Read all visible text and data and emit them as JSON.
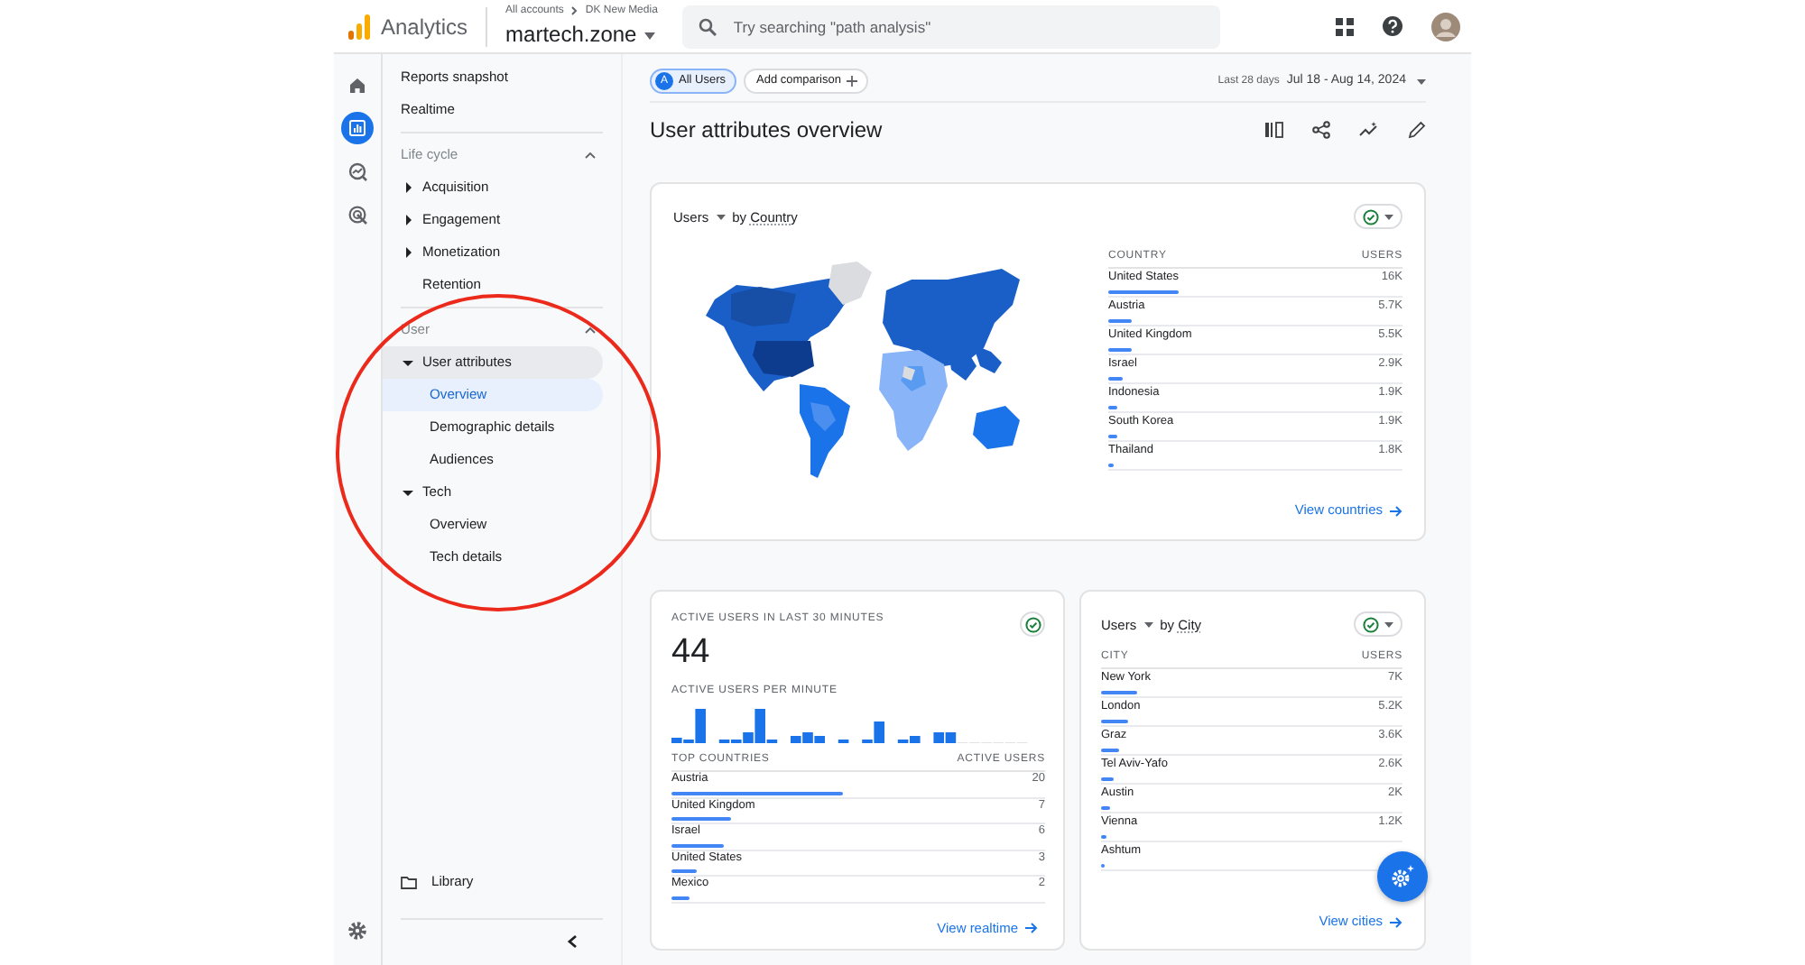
{
  "header": {
    "product": "Analytics",
    "breadcrumb": [
      "All accounts",
      "DK New Media"
    ],
    "property": "martech.zone",
    "search": {
      "placeholder": "Try searching \"path analysis\""
    }
  },
  "rail": [
    {
      "kind": "home",
      "selected": false
    },
    {
      "kind": "reports",
      "selected": true
    },
    {
      "kind": "explore",
      "selected": false
    },
    {
      "kind": "advertising",
      "selected": false
    }
  ],
  "nav": {
    "links": [
      {
        "label": "Reports snapshot",
        "selected": false
      },
      {
        "label": "Realtime",
        "selected": false
      }
    ],
    "sections": [
      {
        "title": "Life cycle",
        "expanded": true,
        "items": [
          {
            "label": "Acquisition",
            "expanded": false,
            "selected": false
          },
          {
            "label": "Engagement",
            "expanded": false,
            "selected": false
          },
          {
            "label": "Monetization",
            "expanded": false,
            "selected": false
          },
          {
            "label": "Retention",
            "selected": false
          }
        ]
      },
      {
        "title": "User",
        "expanded": true,
        "items": [
          {
            "label": "User attributes",
            "expanded": true,
            "selected": false,
            "children": [
              {
                "label": "Overview",
                "selected": true
              },
              {
                "label": "Demographic details",
                "selected": false
              },
              {
                "label": "Audiences",
                "selected": false
              }
            ]
          },
          {
            "label": "Tech",
            "expanded": true,
            "selected": false,
            "children": [
              {
                "label": "Overview",
                "selected": false
              },
              {
                "label": "Tech details",
                "selected": false
              }
            ]
          }
        ]
      }
    ],
    "library": "Library"
  },
  "comparisons": [
    {
      "kind": "segment",
      "letter": "A",
      "label": "All Users"
    },
    {
      "kind": "add",
      "label": "Add comparison"
    }
  ],
  "date": {
    "range_label": "Last 28 days",
    "range": "Jul 18 - Aug 14, 2024"
  },
  "title": "User attributes overview",
  "country_card": {
    "metric": "Users",
    "connector": "by",
    "dimension": "Country",
    "columns": [
      "COUNTRY",
      "USERS"
    ],
    "rows": [
      {
        "name": "United States",
        "value": "16K",
        "level": 0.24
      },
      {
        "name": "Austria",
        "value": "5.7K",
        "level": 0.08
      },
      {
        "name": "United Kingdom",
        "value": "5.5K",
        "level": 0.08
      },
      {
        "name": "Israel",
        "value": "2.9K",
        "level": 0.05
      },
      {
        "name": "Indonesia",
        "value": "1.9K",
        "level": 0.03
      },
      {
        "name": "South Korea",
        "value": "1.9K",
        "level": 0.03
      },
      {
        "name": "Thailand",
        "value": "1.8K",
        "level": 0.02
      }
    ],
    "link": "View countries"
  },
  "realtime_card": {
    "title": "ACTIVE USERS IN LAST 30 MINUTES",
    "value": "44",
    "subtitle": "ACTIVE USERS PER MINUTE",
    "columns": [
      "TOP COUNTRIES",
      "ACTIVE USERS"
    ],
    "rows": [
      {
        "name": "Austria",
        "value": "20",
        "level": 0.46
      },
      {
        "name": "United Kingdom",
        "value": "7",
        "level": 0.16
      },
      {
        "name": "Israel",
        "value": "6",
        "level": 0.14
      },
      {
        "name": "United States",
        "value": "3",
        "level": 0.07
      },
      {
        "name": "Mexico",
        "value": "2",
        "level": 0.05
      }
    ],
    "link": "View realtime"
  },
  "city_card": {
    "metric": "Users",
    "connector": "by",
    "dimension": "City",
    "columns": [
      "CITY",
      "USERS"
    ],
    "rows": [
      {
        "name": "New York",
        "value": "7K",
        "level": 0.12
      },
      {
        "name": "London",
        "value": "5.2K",
        "level": 0.09
      },
      {
        "name": "Graz",
        "value": "3.6K",
        "level": 0.06
      },
      {
        "name": "Tel Aviv-Yafo",
        "value": "2.6K",
        "level": 0.04
      },
      {
        "name": "Austin",
        "value": "2K",
        "level": 0.03
      },
      {
        "name": "Vienna",
        "value": "1.2K",
        "level": 0.02
      },
      {
        "name": "Ashtum",
        "level": 0.01
      }
    ],
    "link": "View cities"
  }
}
